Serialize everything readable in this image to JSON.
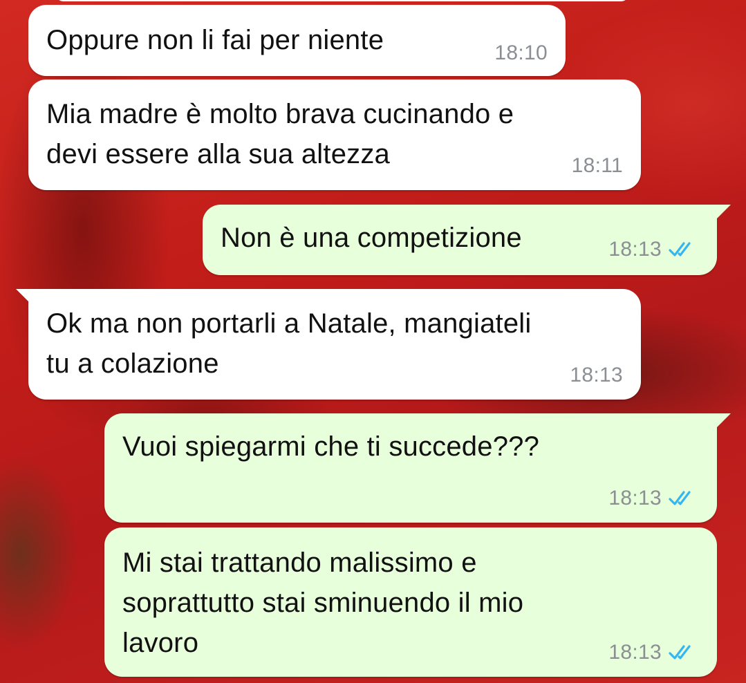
{
  "conversation": {
    "messages": [
      {
        "direction": "incoming",
        "text": "Oppure non li fai per niente",
        "time": "18:10"
      },
      {
        "direction": "incoming",
        "text": "Mia madre è molto brava cucinando e\ndevi essere alla sua altezza",
        "time": "18:11"
      },
      {
        "direction": "outgoing",
        "text": "Non è una competizione",
        "time": "18:13",
        "status": "read"
      },
      {
        "direction": "incoming",
        "text": "Ok ma non portarli a Natale, mangiateli\ntu a colazione",
        "time": "18:13"
      },
      {
        "direction": "outgoing",
        "text": "Vuoi spiegarmi che ti succede???",
        "time": "18:13",
        "status": "read"
      },
      {
        "direction": "outgoing",
        "text": "Mi stai trattando malissimo e\nsoprattutto stai sminuendo il mio\nlavoro",
        "time": "18:13",
        "status": "read"
      }
    ]
  },
  "colors": {
    "incoming_bubble": "#ffffff",
    "outgoing_bubble": "#e7ffdb",
    "read_ticks": "#34b7f1",
    "timestamp": "#8b8f93",
    "wallpaper": "#c8201c"
  },
  "icons": {
    "read_receipt": "double-check-icon"
  }
}
